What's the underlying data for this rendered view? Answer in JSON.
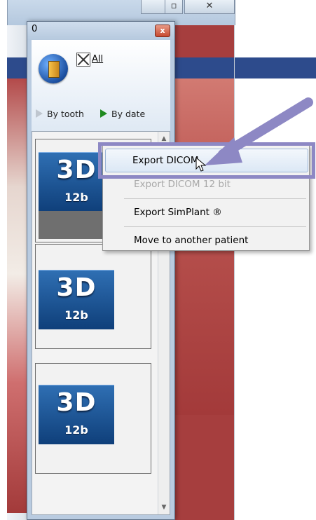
{
  "background": {
    "minimize_glyph": "▫",
    "close_glyph": "✕"
  },
  "dialog": {
    "title": "0",
    "close_glyph": "x",
    "all_label": "All",
    "sort_by_tooth": "By tooth",
    "sort_by_date": "By date"
  },
  "studies": [
    {
      "label": "3D",
      "bits": "12b"
    },
    {
      "label": "3D",
      "bits": "12b"
    },
    {
      "label": "3D",
      "bits": "12b"
    }
  ],
  "context_menu": {
    "items": [
      {
        "label": "Export DICOM",
        "enabled": true,
        "highlighted": true
      },
      {
        "label": "Export DICOM 12 bit",
        "enabled": false
      },
      {
        "label": "Export SimPlant ®",
        "enabled": true
      },
      {
        "label": "Move to another patient",
        "enabled": true
      }
    ]
  },
  "colors": {
    "highlight_frame": "#8d88c4",
    "arrow": "#8d88c4",
    "tile_blue": "#1f5596"
  },
  "icons": {
    "patient": "patient-door-icon",
    "all_checkbox": "checkbox-x-icon",
    "cursor": "mouse-pointer-icon"
  }
}
